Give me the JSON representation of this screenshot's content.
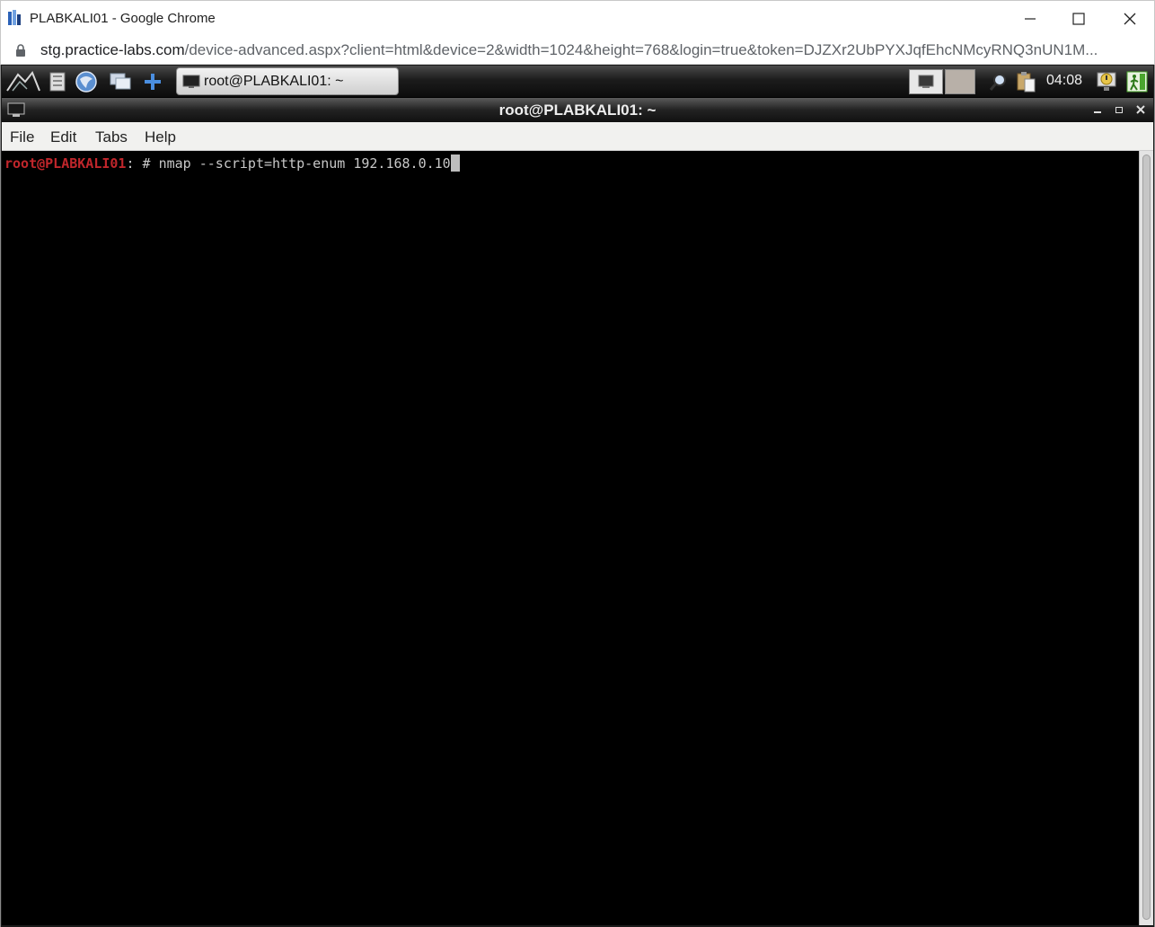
{
  "browser": {
    "window_title": "PLABKALI01 - Google Chrome",
    "url_host": "stg.practice-labs.com",
    "url_path": "/device-advanced.aspx?client=html&device=2&width=1024&height=768&login=true&token=DJZXr2UbPYXJqfEhcNMcyRNQ3nUN1M..."
  },
  "kali_panel": {
    "taskbar_item": "root@PLABKALI01: ~",
    "clock": "04:08",
    "icons": [
      "kali-dragon-icon",
      "file-manager-icon",
      "web-browser-icon",
      "show-desktop-icon",
      "add-launcher-icon",
      "workspace-1-icon",
      "workspace-2-icon",
      "search-icon",
      "clipboard-icon",
      "update-notifier-icon",
      "logout-icon"
    ]
  },
  "terminal": {
    "title": "root@PLABKALI01: ~",
    "menu": [
      "File",
      "Edit",
      "Tabs",
      "Help"
    ],
    "prompt_user": "root@PLABKALI01",
    "prompt_sep": ": # ",
    "command": "nmap --script=http-enum 192.168.0.10"
  },
  "colors": {
    "prompt": "#c0262b",
    "terminal_bg": "#000000",
    "terminal_fg": "#c8c8c8"
  }
}
